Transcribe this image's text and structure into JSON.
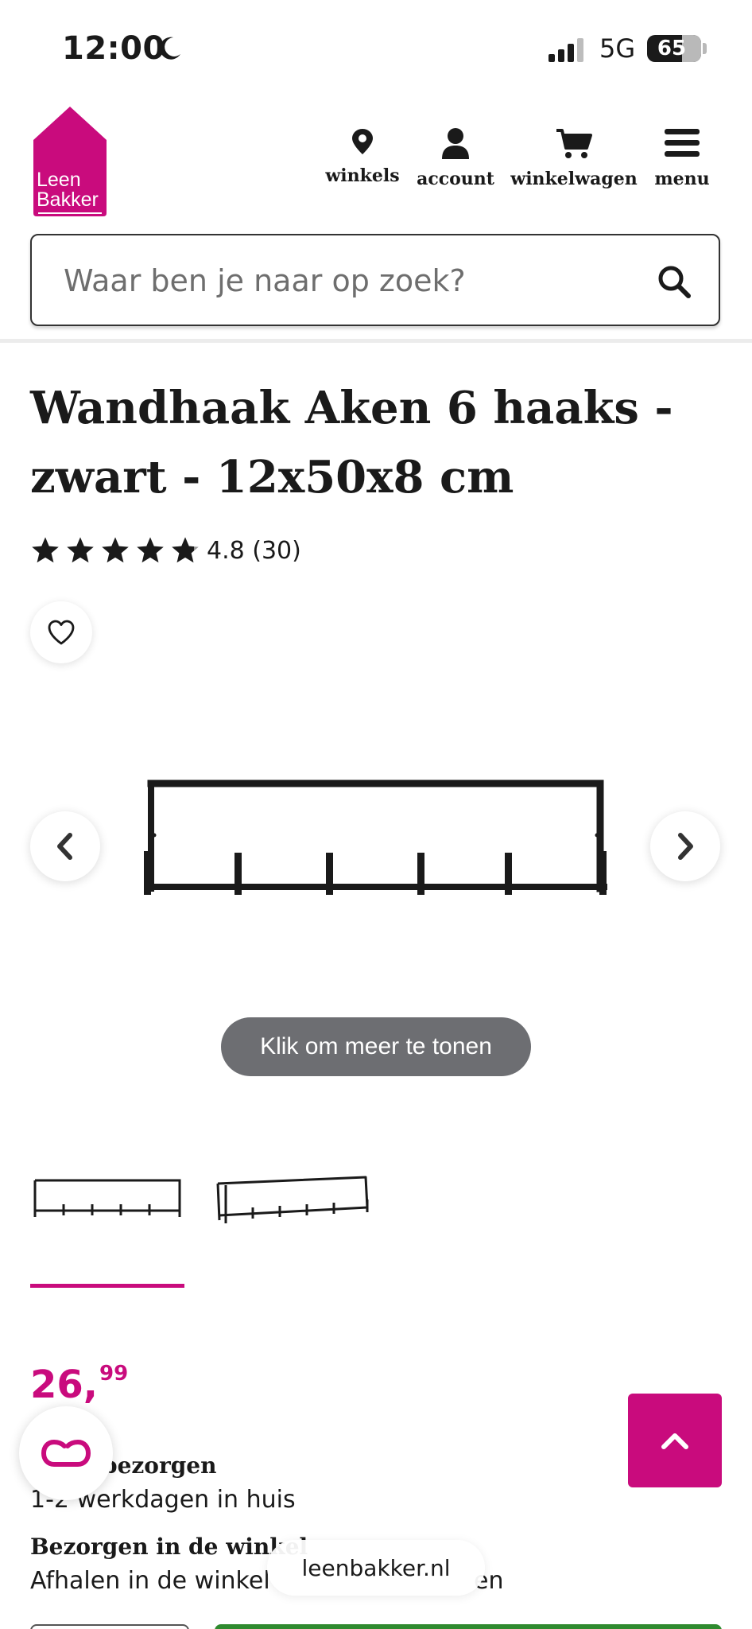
{
  "status_bar": {
    "time": "12:00",
    "network": "5G",
    "battery": "65"
  },
  "header": {
    "logo_text_line1": "Leen",
    "logo_text_line2": "Bakker",
    "nav": [
      {
        "label": "winkels",
        "icon": "location-pin-icon"
      },
      {
        "label": "account",
        "icon": "user-icon"
      },
      {
        "label": "winkelwagen",
        "icon": "cart-icon"
      },
      {
        "label": "menu",
        "icon": "hamburger-menu-icon"
      }
    ]
  },
  "search": {
    "placeholder": "Waar ben je naar op zoek?"
  },
  "product": {
    "title_line1": "Wandhaak Aken 6 haaks -",
    "title_line2": "zwart - 12x50x8 cm",
    "rating_text": "4.8 (30)",
    "rating_value": 4.8,
    "show_more_label": "Klik om meer te tonen",
    "price_main": "26,",
    "price_cents": "99"
  },
  "delivery": {
    "option1_title_visible": "bezorgen",
    "option1_detail": "1-2 werkdagen in huis",
    "option2_title": "Bezorgen in de winkel",
    "option2_detail_left": "Afhalen in de winkel",
    "option2_detail_right": "en"
  },
  "browser": {
    "url": "leenbakker.nl"
  },
  "colors": {
    "brand": "#c90b7d",
    "text": "#1a1a1a",
    "pill": "#6d6e72",
    "green": "#2f8a2f"
  }
}
